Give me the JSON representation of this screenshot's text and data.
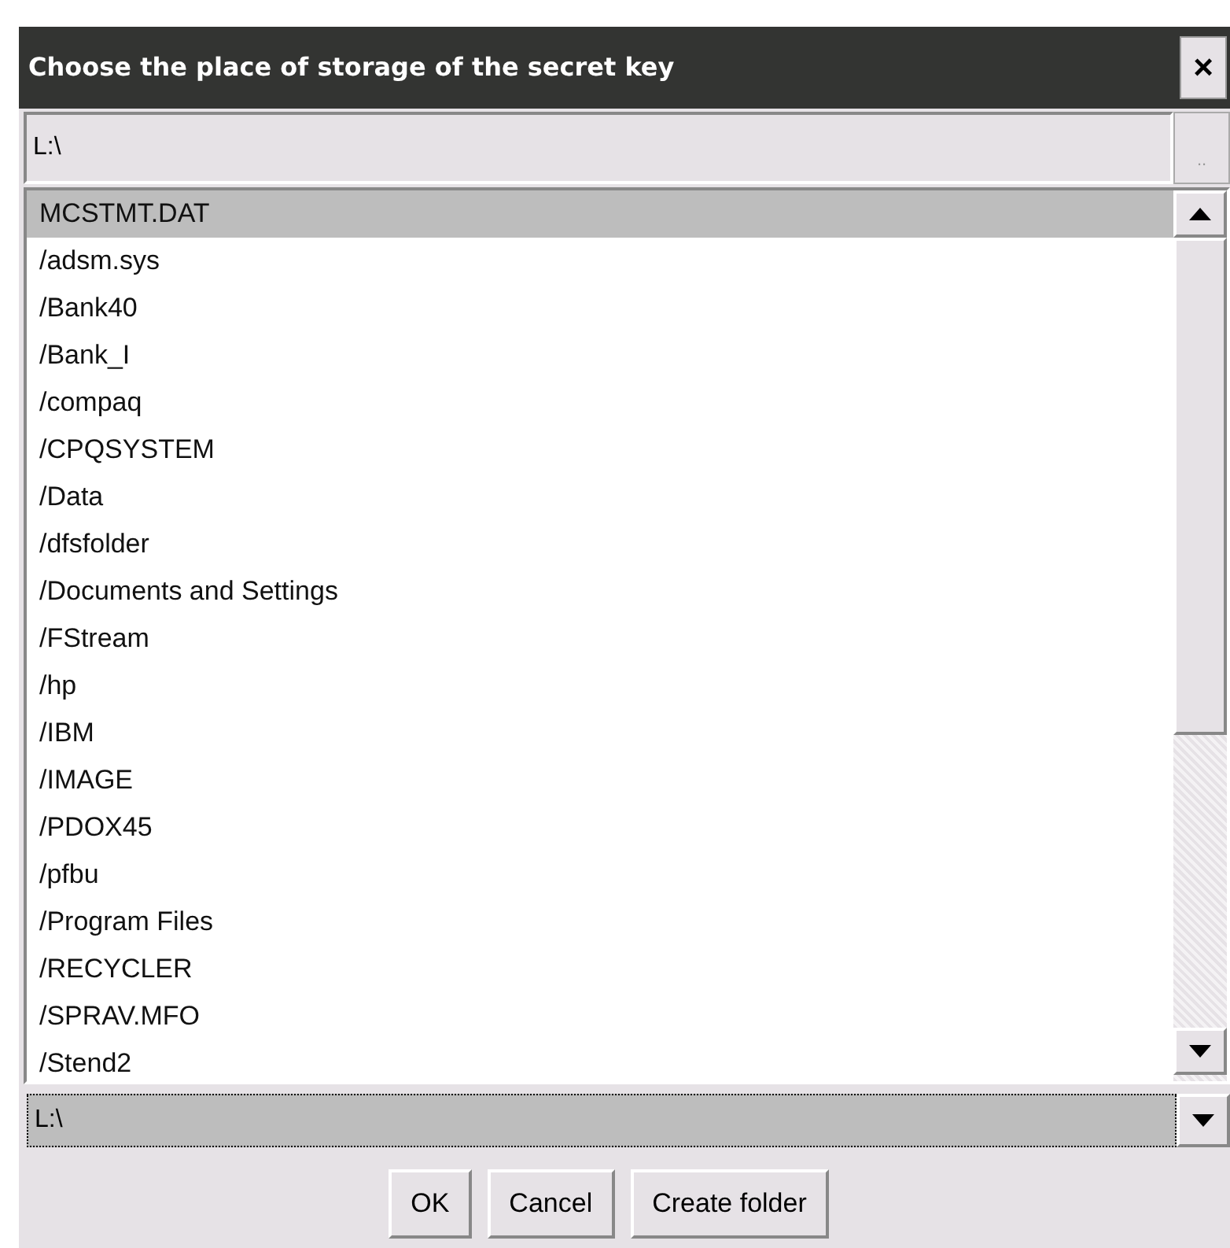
{
  "window": {
    "title": "Choose the place of storage of the secret key",
    "close_label": "×"
  },
  "path_field": {
    "value": "L:\\",
    "browse_label": ".."
  },
  "files": [
    {
      "name": "MCSTMT.DAT",
      "selected": true
    },
    {
      "name": "/adsm.sys",
      "selected": false
    },
    {
      "name": "/Bank40",
      "selected": false
    },
    {
      "name": "/Bank_I",
      "selected": false
    },
    {
      "name": "/compaq",
      "selected": false
    },
    {
      "name": "/CPQSYSTEM",
      "selected": false
    },
    {
      "name": "/Data",
      "selected": false
    },
    {
      "name": "/dfsfolder",
      "selected": false
    },
    {
      "name": "/Documents and Settings",
      "selected": false
    },
    {
      "name": "/FStream",
      "selected": false
    },
    {
      "name": "/hp",
      "selected": false
    },
    {
      "name": "/IBM",
      "selected": false
    },
    {
      "name": "/IMAGE",
      "selected": false
    },
    {
      "name": "/PDOX45",
      "selected": false
    },
    {
      "name": "/pfbu",
      "selected": false
    },
    {
      "name": "/Program Files",
      "selected": false
    },
    {
      "name": "/RECYCLER",
      "selected": false
    },
    {
      "name": "/SPRAV.MFO",
      "selected": false
    },
    {
      "name": "/Stend2",
      "selected": false
    }
  ],
  "drive_select": {
    "value": "L:\\"
  },
  "buttons": [
    "OK",
    "Cancel",
    "Create folder"
  ]
}
